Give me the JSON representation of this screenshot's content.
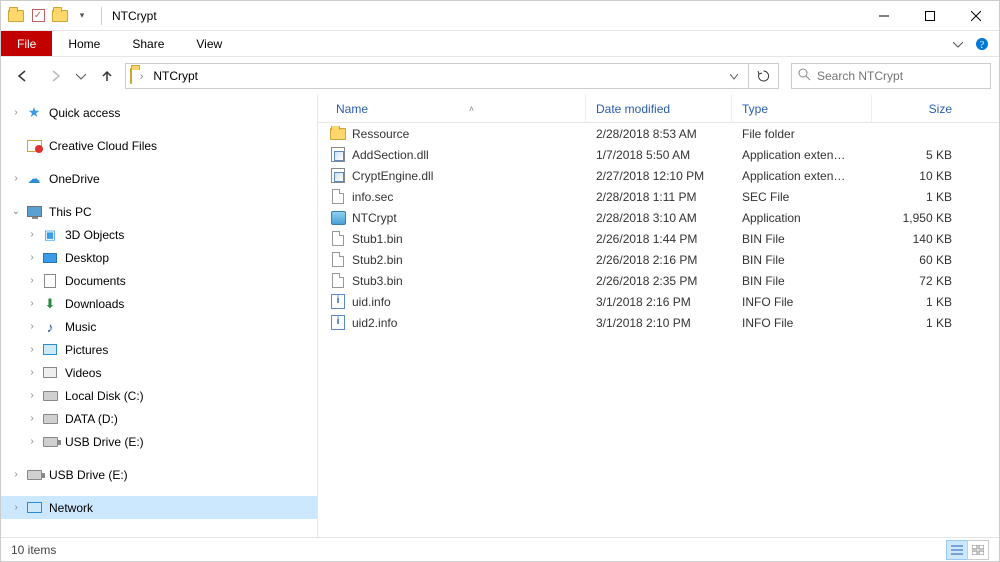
{
  "window": {
    "title": "NTCrypt"
  },
  "ribbon": {
    "file": "File",
    "tabs": [
      "Home",
      "Share",
      "View"
    ]
  },
  "address": {
    "crumb": "NTCrypt"
  },
  "search": {
    "placeholder": "Search NTCrypt"
  },
  "navpane": {
    "quick_access": "Quick access",
    "ccf": "Creative Cloud Files",
    "onedrive": "OneDrive",
    "thispc": "This PC",
    "thispc_children": [
      {
        "icon": "obj3d",
        "label": "3D Objects"
      },
      {
        "icon": "desktop",
        "label": "Desktop"
      },
      {
        "icon": "doc",
        "label": "Documents"
      },
      {
        "icon": "down",
        "label": "Downloads"
      },
      {
        "icon": "music",
        "label": "Music"
      },
      {
        "icon": "pic",
        "label": "Pictures"
      },
      {
        "icon": "vid",
        "label": "Videos"
      },
      {
        "icon": "disk",
        "label": "Local Disk (C:)"
      },
      {
        "icon": "disk",
        "label": "DATA (D:)"
      },
      {
        "icon": "usb",
        "label": "USB Drive (E:)"
      }
    ],
    "usb_outer": "USB Drive (E:)",
    "network": "Network"
  },
  "columns": {
    "name": "Name",
    "date": "Date modified",
    "type": "Type",
    "size": "Size"
  },
  "files": [
    {
      "icon": "folder",
      "name": "Ressource",
      "date": "2/28/2018 8:53 AM",
      "type": "File folder",
      "size": ""
    },
    {
      "icon": "dll",
      "name": "AddSection.dll",
      "date": "1/7/2018 5:50 AM",
      "type": "Application exten…",
      "size": "5 KB"
    },
    {
      "icon": "dll",
      "name": "CryptEngine.dll",
      "date": "2/27/2018 12:10 PM",
      "type": "Application exten…",
      "size": "10 KB"
    },
    {
      "icon": "file",
      "name": "info.sec",
      "date": "2/28/2018 1:11 PM",
      "type": "SEC File",
      "size": "1 KB"
    },
    {
      "icon": "app",
      "name": "NTCrypt",
      "date": "2/28/2018 3:10 AM",
      "type": "Application",
      "size": "1,950 KB"
    },
    {
      "icon": "file",
      "name": "Stub1.bin",
      "date": "2/26/2018 1:44 PM",
      "type": "BIN File",
      "size": "140 KB"
    },
    {
      "icon": "file",
      "name": "Stub2.bin",
      "date": "2/26/2018 2:16 PM",
      "type": "BIN File",
      "size": "60 KB"
    },
    {
      "icon": "file",
      "name": "Stub3.bin",
      "date": "2/26/2018 2:35 PM",
      "type": "BIN File",
      "size": "72 KB"
    },
    {
      "icon": "info",
      "name": "uid.info",
      "date": "3/1/2018 2:16 PM",
      "type": "INFO File",
      "size": "1 KB"
    },
    {
      "icon": "info",
      "name": "uid2.info",
      "date": "3/1/2018 2:10 PM",
      "type": "INFO File",
      "size": "1 KB"
    }
  ],
  "status": {
    "count": "10 items"
  }
}
